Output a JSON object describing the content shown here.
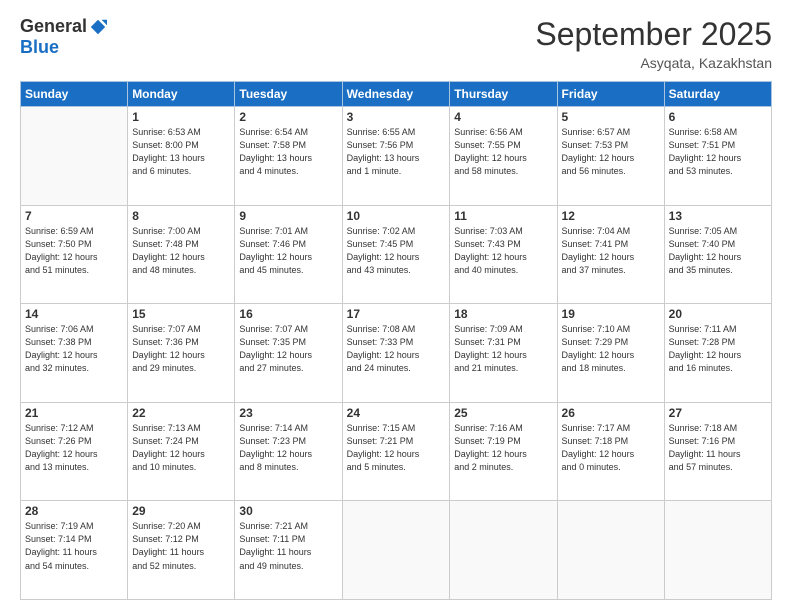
{
  "logo": {
    "general": "General",
    "blue": "Blue"
  },
  "header": {
    "month": "September 2025",
    "location": "Asyqata, Kazakhstan"
  },
  "weekdays": [
    "Sunday",
    "Monday",
    "Tuesday",
    "Wednesday",
    "Thursday",
    "Friday",
    "Saturday"
  ],
  "weeks": [
    [
      {
        "day": "",
        "info": ""
      },
      {
        "day": "1",
        "info": "Sunrise: 6:53 AM\nSunset: 8:00 PM\nDaylight: 13 hours\nand 6 minutes."
      },
      {
        "day": "2",
        "info": "Sunrise: 6:54 AM\nSunset: 7:58 PM\nDaylight: 13 hours\nand 4 minutes."
      },
      {
        "day": "3",
        "info": "Sunrise: 6:55 AM\nSunset: 7:56 PM\nDaylight: 13 hours\nand 1 minute."
      },
      {
        "day": "4",
        "info": "Sunrise: 6:56 AM\nSunset: 7:55 PM\nDaylight: 12 hours\nand 58 minutes."
      },
      {
        "day": "5",
        "info": "Sunrise: 6:57 AM\nSunset: 7:53 PM\nDaylight: 12 hours\nand 56 minutes."
      },
      {
        "day": "6",
        "info": "Sunrise: 6:58 AM\nSunset: 7:51 PM\nDaylight: 12 hours\nand 53 minutes."
      }
    ],
    [
      {
        "day": "7",
        "info": "Sunrise: 6:59 AM\nSunset: 7:50 PM\nDaylight: 12 hours\nand 51 minutes."
      },
      {
        "day": "8",
        "info": "Sunrise: 7:00 AM\nSunset: 7:48 PM\nDaylight: 12 hours\nand 48 minutes."
      },
      {
        "day": "9",
        "info": "Sunrise: 7:01 AM\nSunset: 7:46 PM\nDaylight: 12 hours\nand 45 minutes."
      },
      {
        "day": "10",
        "info": "Sunrise: 7:02 AM\nSunset: 7:45 PM\nDaylight: 12 hours\nand 43 minutes."
      },
      {
        "day": "11",
        "info": "Sunrise: 7:03 AM\nSunset: 7:43 PM\nDaylight: 12 hours\nand 40 minutes."
      },
      {
        "day": "12",
        "info": "Sunrise: 7:04 AM\nSunset: 7:41 PM\nDaylight: 12 hours\nand 37 minutes."
      },
      {
        "day": "13",
        "info": "Sunrise: 7:05 AM\nSunset: 7:40 PM\nDaylight: 12 hours\nand 35 minutes."
      }
    ],
    [
      {
        "day": "14",
        "info": "Sunrise: 7:06 AM\nSunset: 7:38 PM\nDaylight: 12 hours\nand 32 minutes."
      },
      {
        "day": "15",
        "info": "Sunrise: 7:07 AM\nSunset: 7:36 PM\nDaylight: 12 hours\nand 29 minutes."
      },
      {
        "day": "16",
        "info": "Sunrise: 7:07 AM\nSunset: 7:35 PM\nDaylight: 12 hours\nand 27 minutes."
      },
      {
        "day": "17",
        "info": "Sunrise: 7:08 AM\nSunset: 7:33 PM\nDaylight: 12 hours\nand 24 minutes."
      },
      {
        "day": "18",
        "info": "Sunrise: 7:09 AM\nSunset: 7:31 PM\nDaylight: 12 hours\nand 21 minutes."
      },
      {
        "day": "19",
        "info": "Sunrise: 7:10 AM\nSunset: 7:29 PM\nDaylight: 12 hours\nand 18 minutes."
      },
      {
        "day": "20",
        "info": "Sunrise: 7:11 AM\nSunset: 7:28 PM\nDaylight: 12 hours\nand 16 minutes."
      }
    ],
    [
      {
        "day": "21",
        "info": "Sunrise: 7:12 AM\nSunset: 7:26 PM\nDaylight: 12 hours\nand 13 minutes."
      },
      {
        "day": "22",
        "info": "Sunrise: 7:13 AM\nSunset: 7:24 PM\nDaylight: 12 hours\nand 10 minutes."
      },
      {
        "day": "23",
        "info": "Sunrise: 7:14 AM\nSunset: 7:23 PM\nDaylight: 12 hours\nand 8 minutes."
      },
      {
        "day": "24",
        "info": "Sunrise: 7:15 AM\nSunset: 7:21 PM\nDaylight: 12 hours\nand 5 minutes."
      },
      {
        "day": "25",
        "info": "Sunrise: 7:16 AM\nSunset: 7:19 PM\nDaylight: 12 hours\nand 2 minutes."
      },
      {
        "day": "26",
        "info": "Sunrise: 7:17 AM\nSunset: 7:18 PM\nDaylight: 12 hours\nand 0 minutes."
      },
      {
        "day": "27",
        "info": "Sunrise: 7:18 AM\nSunset: 7:16 PM\nDaylight: 11 hours\nand 57 minutes."
      }
    ],
    [
      {
        "day": "28",
        "info": "Sunrise: 7:19 AM\nSunset: 7:14 PM\nDaylight: 11 hours\nand 54 minutes."
      },
      {
        "day": "29",
        "info": "Sunrise: 7:20 AM\nSunset: 7:12 PM\nDaylight: 11 hours\nand 52 minutes."
      },
      {
        "day": "30",
        "info": "Sunrise: 7:21 AM\nSunset: 7:11 PM\nDaylight: 11 hours\nand 49 minutes."
      },
      {
        "day": "",
        "info": ""
      },
      {
        "day": "",
        "info": ""
      },
      {
        "day": "",
        "info": ""
      },
      {
        "day": "",
        "info": ""
      }
    ]
  ]
}
